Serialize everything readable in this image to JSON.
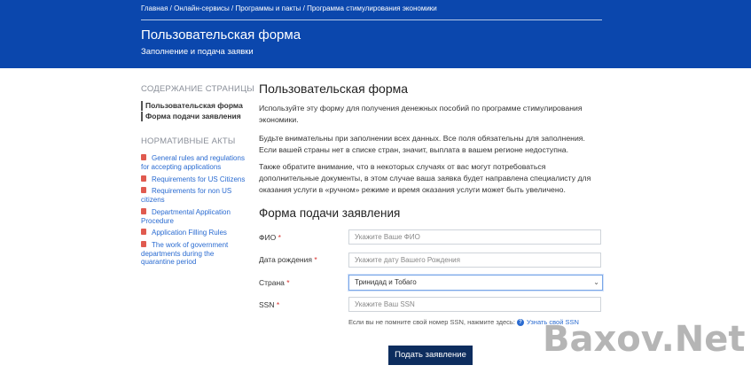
{
  "header": {
    "breadcrumb": [
      "Главная",
      "Онлайн-сервисы",
      "Программы и пакты",
      "Программа стимулирования экономики"
    ],
    "breadcrumb_sep": " / ",
    "title": "Пользовательская форма",
    "subtitle": "Заполнение и подача заявки"
  },
  "sidebar": {
    "toc_heading": "СОДЕРЖАНИЕ СТРАНИЦЫ",
    "toc_items": [
      "Пользовательская форма",
      "Форма подачи заявления"
    ],
    "acts_heading": "НОРМАТИВНЫЕ АКТЫ",
    "acts": [
      "General rules and regulations for accepting applications",
      "Requirements for US Citizens",
      "Requirements for non US citizens",
      "Departmental Application Procedure",
      "Application Filling Rules",
      "The work of government departments during the quarantine period"
    ]
  },
  "main": {
    "title": "Пользовательская форма",
    "paragraphs": [
      "Используйте эту форму для получения денежных пособий по программе стимулирования экономики.",
      "Будьте внимательны при заполнении всех данных. Все поля обязательны для заполнения. Если вашей страны нет в списке стран, значит, выплата в вашем регионе недоступна.",
      "Также обратите внимание, что в некоторых случаях от вас могут потребоваться дополнительные документы, в этом случае ваша заявка будет направлена специалисту для оказания услуги в «ручном» режиме и время оказания услуги может быть увеличено."
    ],
    "form_title": "Форма подачи заявления"
  },
  "form": {
    "required_mark": "*",
    "fio_label": "ФИО",
    "fio_placeholder": "Укажите Ваше ФИО",
    "dob_label": "Дата рождения",
    "dob_placeholder": "Укажите дату Вашего Рождения",
    "country_label": "Страна",
    "country_value": "Тринидад и Тобаго",
    "ssn_label": "SSN",
    "ssn_placeholder": "Укажите Ваш SSN",
    "ssn_hint": "Если вы не помните свой номер SSN, нажмите здесь:",
    "ssn_link": "Узнать свой SSN",
    "submit_label": "Подать заявление"
  },
  "watermark": "Baxov.Net",
  "colors": {
    "header_bg": "#0b47ad",
    "button_bg": "#0d2d5e",
    "link": "#2a6bd1",
    "required": "#d9302c"
  }
}
